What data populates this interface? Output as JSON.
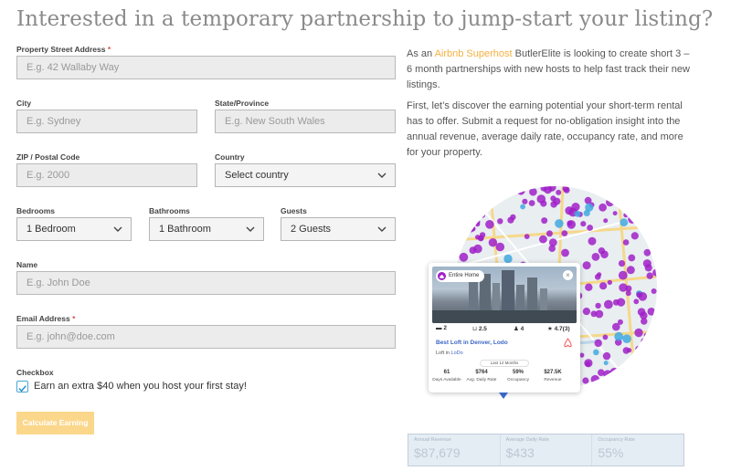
{
  "page": {
    "title": "Interested in a temporary partnership to jump-start your listing?"
  },
  "form": {
    "street": {
      "label": "Property Street Address",
      "required": "*",
      "placeholder": "E.g. 42 Wallaby Way"
    },
    "city": {
      "label": "City",
      "placeholder": "E.g. Sydney"
    },
    "state": {
      "label": "State/Province",
      "placeholder": "E.g. New South Wales"
    },
    "zip": {
      "label": "ZIP / Postal Code",
      "placeholder": "E.g. 2000"
    },
    "country": {
      "label": "Country",
      "value": "Select country"
    },
    "bedrooms": {
      "label": "Bedrooms",
      "value": "1 Bedroom"
    },
    "bathrooms": {
      "label": "Bathrooms",
      "value": "1 Bathroom"
    },
    "guests": {
      "label": "Guests",
      "value": "2 Guests"
    },
    "name": {
      "label": "Name",
      "placeholder": "E.g. John Doe"
    },
    "email": {
      "label": "Email Address",
      "required": "*",
      "placeholder": "E.g. john@doe.com"
    },
    "checkbox": {
      "label": "Checkbox",
      "text": "Earn an extra $40 when you host your first stay!",
      "checked": true
    },
    "submit_label": "Calculate Earning"
  },
  "intro": {
    "p1_before": "As an ",
    "p1_link": "Airbnb Superhost",
    "p1_after": " ButlerElite is looking to create short 3 – 6 month partnerships with new hosts to help fast track their new listings.",
    "p2": "First, let’s discover the earning potential your short-term rental has to offer.  Submit a request for no-obligation insight into the annual revenue, average daily rate, occupancy rate, and more for your property."
  },
  "card": {
    "pill": "Entire Home",
    "close": "×",
    "beds": "2",
    "baths": "2.5",
    "guests": "4",
    "rating": "4.7(3)",
    "listing_title": "Best Loft in Denver, Lodo",
    "location_prefix": "Loft in ",
    "location_link": "LoDo",
    "period": "Last 12 Months",
    "stats": [
      {
        "value": "61",
        "label": "Days Available"
      },
      {
        "value": "$764",
        "label": "Avg. Daily Rate"
      },
      {
        "value": "59%",
        "label": "Occupancy"
      },
      {
        "value": "$27.5K",
        "label": "Revenue"
      }
    ]
  },
  "metrics": [
    {
      "label": "Annual Revenue",
      "value": "$87,679"
    },
    {
      "label": "Average Daily Rate",
      "value": "$433"
    },
    {
      "label": "Occupancy Rate",
      "value": "55%"
    }
  ],
  "colors": {
    "accent": "#f5b041",
    "button": "#fbd78b",
    "map_dot": "#a020c8",
    "map_dot_alt": "#3fa9e0",
    "link": "#3b66c4"
  },
  "icons": {
    "chevron": "chevron-down-icon",
    "check": "check-icon",
    "airbnb": "airbnb-logo-icon"
  }
}
